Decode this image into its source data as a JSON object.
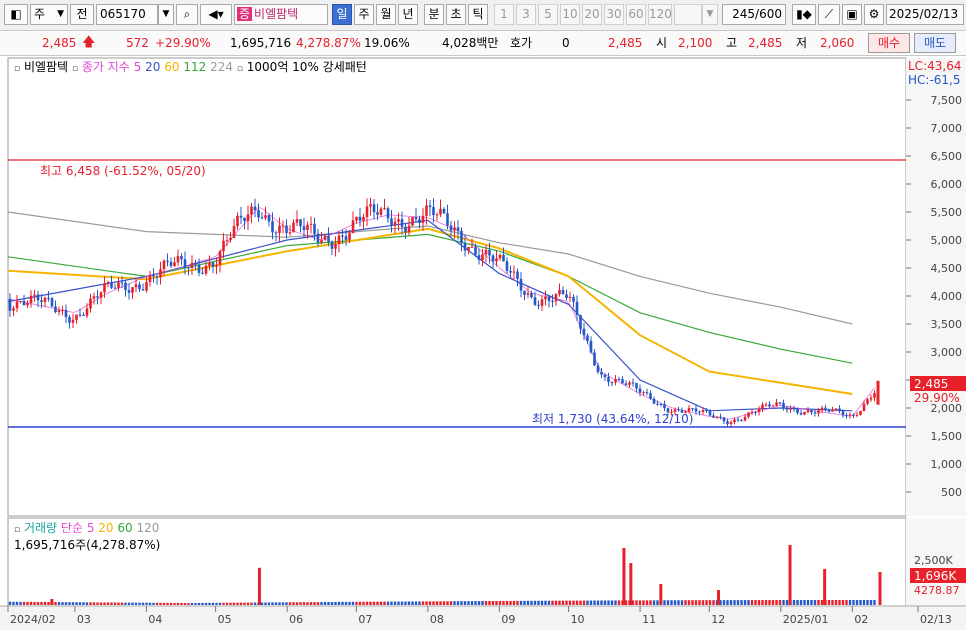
{
  "toolbar": {
    "market_label": "주",
    "type_label": "전",
    "code_value": "065170",
    "stock_badge": "증",
    "stock_name": "비엘팜텍",
    "period_tabs": [
      "일",
      "주",
      "월",
      "년",
      "분",
      "초",
      "틱"
    ],
    "interval_options": [
      "1",
      "3",
      "5",
      "10",
      "20",
      "30",
      "60",
      "120"
    ],
    "count_value": "245",
    "count_total": "/600",
    "date_value": "2025/02/13"
  },
  "infobar": {
    "price": "2,485",
    "change": "572",
    "change_pct": "+29.90%",
    "volume": "1,695,716",
    "volume_ratio": "4,278.87%",
    "turnover": "19.06%",
    "amount": "4,028백만",
    "quote_label": "호가",
    "quote_value": "0",
    "quote_price": "2,485",
    "open_label": "시",
    "open_value": "2,100",
    "high_label": "고",
    "high_value": "2,485",
    "low_label": "저",
    "low_value": "2,060",
    "buy_label": "매수",
    "sell_label": "매도"
  },
  "price_panel": {
    "legend_name": "비엘팜텍",
    "legend_ma_label": "종가 지수",
    "legend_periods": [
      "5",
      "20",
      "60",
      "112",
      "224"
    ],
    "legend_extra": "1000억 10% 강세패턴",
    "lc_label": "LC:43,64",
    "hc_label": "HC:-61,5",
    "high_annotation": "최고 6,458 (-61.52%, 05/20)",
    "low_annotation": "최저 1,730 (43.64%, 12/10)",
    "current_price_tag": "2,485",
    "current_pct_tag": "29.90%"
  },
  "volume_panel": {
    "legend_name": "거래량",
    "legend_ma_label": "단순",
    "legend_periods": [
      "5",
      "20",
      "60",
      "120"
    ],
    "volume_text": "1,695,716주(4,278.87%)",
    "current_vol_tag": "1,696K",
    "current_vol_pct": "4278.87"
  },
  "colors": {
    "up": "#e8202a",
    "down": "#2458c8",
    "ma5": "#e24ad4",
    "ma20": "#3652c8",
    "ma60": "#f4b400",
    "ma112": "#3aa83a",
    "ma224": "#9a9a9a",
    "plot_bg": "#ffffff",
    "axis_bg": "#f3f3f3"
  },
  "chart_data": [
    {
      "type": "candlestick",
      "title": "비엘팜텍",
      "ylim": [
        0,
        8000
      ],
      "y_ticks": [
        "7,500",
        "7,000",
        "6,500",
        "6,000",
        "5,500",
        "5,000",
        "4,500",
        "4,000",
        "3,500",
        "3,000",
        "2,500",
        "2,000",
        "1,500",
        "1,000",
        "500"
      ],
      "y_tick_values": [
        7500,
        7000,
        6500,
        6000,
        5500,
        5000,
        4500,
        4000,
        3500,
        3000,
        2500,
        2000,
        1500,
        1000,
        500
      ],
      "x_labels": [
        "2024/02",
        "03",
        "04",
        "05",
        "06",
        "07",
        "08",
        "09",
        "10",
        "11",
        "12",
        "2025/01",
        "02",
        "02/13"
      ],
      "x_label_dates": [
        "2024-02",
        "2024-03",
        "2024-04",
        "2024-05",
        "2024-06",
        "2024-07",
        "2024-08",
        "2024-09",
        "2024-10",
        "2024-11",
        "2024-12",
        "2025-01",
        "2025-02",
        "2025-02-13"
      ],
      "grid": false,
      "high_line": 6458,
      "low_line": 1730,
      "close_key_points": [
        [
          "2024-02",
          3950
        ],
        [
          "2024-03",
          3700
        ],
        [
          "2024-03-15",
          4050
        ],
        [
          "2024-04",
          4350
        ],
        [
          "2024-04-15",
          4500
        ],
        [
          "2024-05",
          4700
        ],
        [
          "2024-05-20",
          5600
        ],
        [
          "2024-06",
          5200
        ],
        [
          "2024-06-15",
          5000
        ],
        [
          "2024-07",
          5300
        ],
        [
          "2024-07-15",
          5450
        ],
        [
          "2024-08",
          5400
        ],
        [
          "2024-08-15",
          5150
        ],
        [
          "2024-09",
          4500
        ],
        [
          "2024-09-15",
          4050
        ],
        [
          "2024-10",
          3900
        ],
        [
          "2024-10-15",
          2650
        ],
        [
          "2024-11",
          2250
        ],
        [
          "2024-11-15",
          2000
        ],
        [
          "2024-12",
          1850
        ],
        [
          "2024-12-10",
          1800
        ],
        [
          "2025-01",
          2050
        ],
        [
          "2025-01-15",
          1950
        ],
        [
          "2025-02",
          1850
        ],
        [
          "2025-02-13",
          2485
        ]
      ],
      "ma_series": [
        {
          "name": "112",
          "values": [
            [
              "2024-02",
              4700
            ],
            [
              "2024-04",
              4350
            ],
            [
              "2024-06",
              4900
            ],
            [
              "2024-08",
              5100
            ],
            [
              "2024-09",
              4800
            ],
            [
              "2024-10",
              4350
            ],
            [
              "2024-11",
              3700
            ],
            [
              "2024-12",
              3350
            ],
            [
              "2025-01",
              3050
            ],
            [
              "2025-02",
              2800
            ]
          ]
        },
        {
          "name": "224",
          "values": [
            [
              "2024-02",
              5500
            ],
            [
              "2024-04",
              5150
            ],
            [
              "2024-06",
              5050
            ],
            [
              "2024-08",
              5250
            ],
            [
              "2024-09",
              4950
            ],
            [
              "2024-10",
              4750
            ],
            [
              "2024-11",
              4350
            ],
            [
              "2024-12",
              4050
            ],
            [
              "2025-01",
              3800
            ],
            [
              "2025-02",
              3500
            ]
          ]
        },
        {
          "name": "60",
          "values": [
            [
              "2024-02",
              4450
            ],
            [
              "2024-04",
              4300
            ],
            [
              "2024-06",
              4800
            ],
            [
              "2024-08",
              5200
            ],
            [
              "2024-09",
              4850
            ],
            [
              "2024-10",
              4350
            ],
            [
              "2024-11",
              3300
            ],
            [
              "2024-12",
              2650
            ],
            [
              "2025-01",
              2450
            ],
            [
              "2025-02",
              2250
            ]
          ]
        },
        {
          "name": "20",
          "values": [
            [
              "2024-02",
              3900
            ],
            [
              "2024-04",
              4350
            ],
            [
              "2024-06",
              5000
            ],
            [
              "2024-08",
              5350
            ],
            [
              "2024-09",
              4400
            ],
            [
              "2024-10",
              3850
            ],
            [
              "2024-11",
              2500
            ],
            [
              "2024-12",
              1950
            ],
            [
              "2025-01",
              2000
            ],
            [
              "2025-02",
              1950
            ]
          ]
        }
      ]
    },
    {
      "type": "bar",
      "title": "거래량",
      "y_ticks": [
        "2,500K"
      ],
      "spikes": [
        [
          "2024-02-20",
          0.1
        ],
        [
          "2024-05-20",
          0.62
        ],
        [
          "2024-10-25",
          0.95
        ],
        [
          "2024-10-28",
          0.7
        ],
        [
          "2024-11-10",
          0.35
        ],
        [
          "2024-12-05",
          0.25
        ],
        [
          "2025-01-05",
          1.0
        ],
        [
          "2025-01-20",
          0.6
        ],
        [
          "2025-02-13",
          0.55
        ]
      ]
    }
  ]
}
